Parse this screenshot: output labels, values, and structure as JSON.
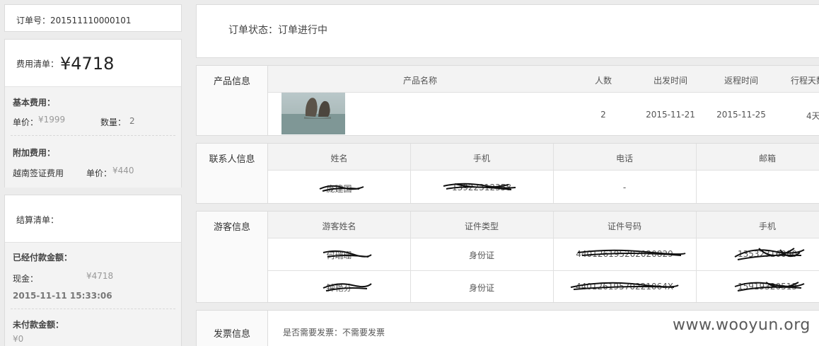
{
  "order": {
    "label": "订单号：",
    "number": "201511110000101"
  },
  "fee": {
    "label": "费用清单：",
    "total": "¥4718",
    "basic_title": "基本费用：",
    "unit_price_label": "单价：",
    "unit_price": "¥1999",
    "qty_label": "数量：",
    "qty": "2",
    "extra_title": "附加费用：",
    "extra_item": "越南签证费用",
    "extra_price_label": "单价：",
    "extra_price": "¥440"
  },
  "settle": {
    "label": "结算清单：",
    "paid_title": "已经付款金额：",
    "cash_label": "现金：",
    "cash_value": "¥4718",
    "paid_time": "2015-11-11 15:33:06",
    "unpaid_title": "未付款金额：",
    "unpaid_value": "¥0"
  },
  "status": {
    "text": "订单状态：订单进行中"
  },
  "product": {
    "section": "产品信息",
    "headers": [
      "产品名称",
      "人数",
      "出发时间",
      "返程时间",
      "行程天数"
    ],
    "row": {
      "people": "2",
      "depart": "2015-11-21",
      "return": "2015-11-25",
      "days": "4天"
    }
  },
  "contact": {
    "section": "联系人信息",
    "headers": [
      "姓名",
      "手机",
      "电话",
      "邮箱"
    ],
    "row": {
      "name": "庞建国",
      "mobile": "13922312358",
      "phone": "-",
      "email": ""
    }
  },
  "tourist": {
    "section": "游客信息",
    "headers": [
      "游客姓名",
      "证件类型",
      "证件号码",
      "手机"
    ],
    "rows": [
      {
        "name": "何瑞珊",
        "id_type": "身份证",
        "id_no": "440126195202020829",
        "mobile": "13532316000"
      },
      {
        "name": "钟艳芬",
        "id_type": "身份证",
        "id_no": "44012619570221064X",
        "mobile": "15919320513"
      }
    ]
  },
  "invoice": {
    "section": "发票信息",
    "text": "是否需要发票：不需要发票"
  },
  "watermark": "www.wooyun.org"
}
